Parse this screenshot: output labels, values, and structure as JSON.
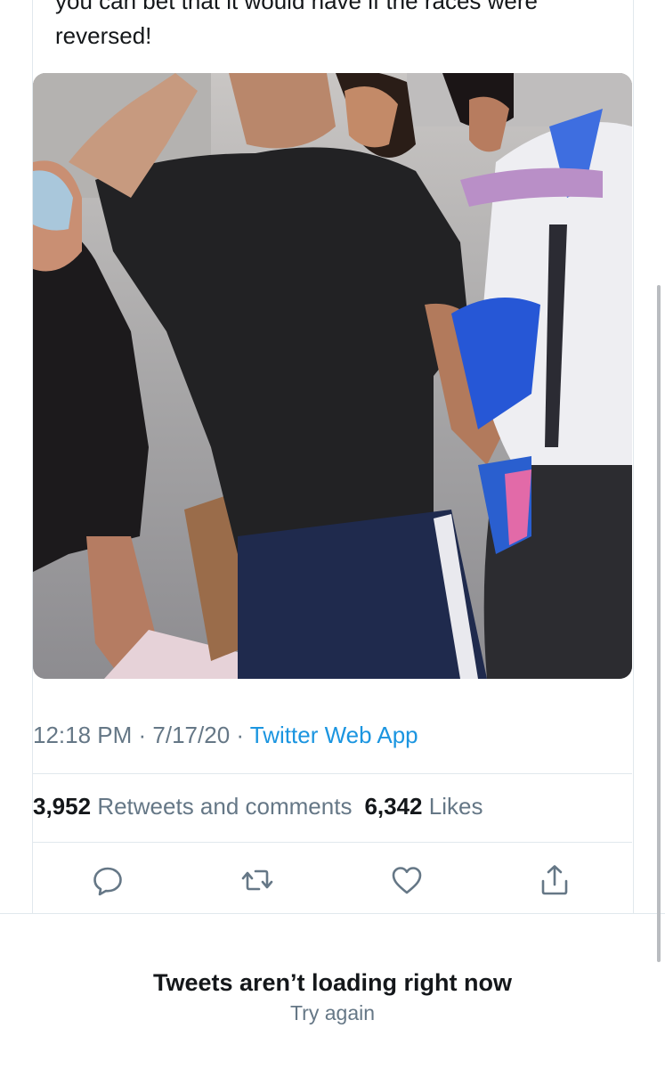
{
  "tweet": {
    "text_lines": [
      "you can bet that it would have if the races were",
      "reversed!"
    ],
    "timestamp": "12:18 PM",
    "separator": " · ",
    "date": "7/17/20",
    "source": "Twitter Web App"
  },
  "stats": {
    "retweets_count": "3,952",
    "retweets_label": "Retweets and comments",
    "likes_count": "6,342",
    "likes_label": "Likes"
  },
  "actions": {
    "icons": [
      "reply-icon",
      "retweet-icon",
      "like-icon",
      "share-icon"
    ]
  },
  "error": {
    "title": "Tweets aren’t loading right now",
    "retry_label": "Try again"
  },
  "colors": {
    "link": "#1b95e0",
    "secondary_text": "#657786",
    "primary_text": "#14171a",
    "divider": "#e1e8ed"
  }
}
